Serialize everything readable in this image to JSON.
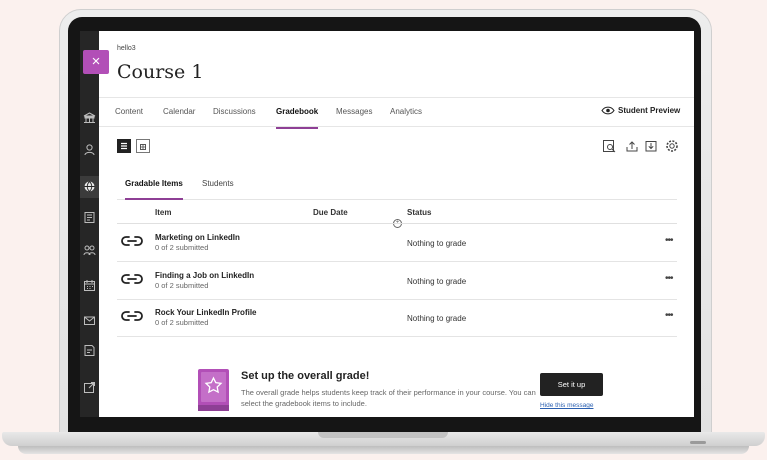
{
  "course": {
    "code": "hello3",
    "title": "Course 1"
  },
  "nav_tabs": [
    {
      "label": "Content"
    },
    {
      "label": "Calendar"
    },
    {
      "label": "Discussions"
    },
    {
      "label": "Gradebook",
      "active": true
    },
    {
      "label": "Messages"
    },
    {
      "label": "Analytics"
    }
  ],
  "student_preview_label": "Student Preview",
  "subtabs": [
    {
      "label": "Gradable Items",
      "active": true
    },
    {
      "label": "Students"
    }
  ],
  "columns": {
    "item": "Item",
    "due_date": "Due Date",
    "status": "Status"
  },
  "rows": [
    {
      "title": "Marketing on LinkedIn",
      "submitted": "0 of 2 submitted",
      "status": "Nothing to grade"
    },
    {
      "title": "Finding a Job on LinkedIn",
      "submitted": "0 of 2 submitted",
      "status": "Nothing to grade"
    },
    {
      "title": "Rock Your LinkedIn Profile",
      "submitted": "0 of 2 submitted",
      "status": "Nothing to grade"
    }
  ],
  "row_more_glyph": "•••",
  "cta": {
    "title": "Set up the overall grade!",
    "description": "The overall grade helps students keep track of their performance in your course. You can select the gradebook items to include.",
    "button": "Set it up",
    "hide_link": "Hide this message"
  },
  "icons": {
    "close": "×",
    "left_nav": [
      "institution-icon",
      "profile-icon",
      "globe-icon",
      "courses-icon",
      "organizations-icon",
      "calendar-icon",
      "messages-icon",
      "grades-icon",
      "tools-icon"
    ]
  },
  "colors": {
    "accent": "#8e3f95",
    "close_tab": "#b24fb7",
    "cta_book": "#b24fb7"
  }
}
